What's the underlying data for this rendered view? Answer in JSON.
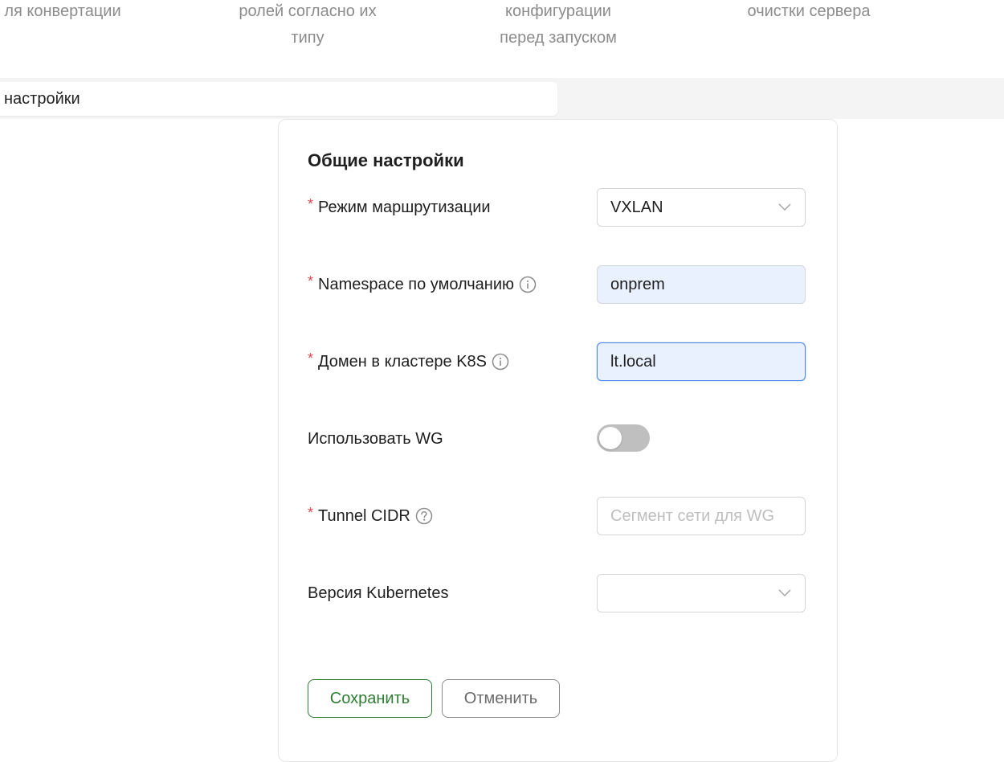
{
  "steps": [
    {
      "label": "ля конвертации"
    },
    {
      "label": "ролей согласно их\nтипу"
    },
    {
      "label": "конфигурации\nперед запуском"
    },
    {
      "label": "очистки сервера"
    }
  ],
  "tab": {
    "label": "настройки"
  },
  "form": {
    "title": "Общие настройки",
    "required_mark": "*",
    "routing_mode": {
      "label": "Режим маршрутизации",
      "value": "VXLAN"
    },
    "namespace": {
      "label": "Namespace по умолчанию",
      "value": "onprem"
    },
    "cluster_domain": {
      "label": "Домен в кластере K8S",
      "value": "lt.local"
    },
    "use_wg": {
      "label": "Использовать WG",
      "enabled": false
    },
    "tunnel_cidr": {
      "label": "Tunnel CIDR",
      "value": "",
      "placeholder": "Сегмент сети для WG"
    },
    "k8s_version": {
      "label": "Версия Kubernetes",
      "value": ""
    }
  },
  "buttons": {
    "save": "Сохранить",
    "cancel": "Отменить"
  },
  "colors": {
    "required": "#e5484d",
    "save_border": "#2e7d32",
    "focus_border": "#4a86e8",
    "filled_bg": "#e9f0fe",
    "toggle_off": "#bfbfbf"
  },
  "icons": {
    "info": "info-circle-icon",
    "help": "question-circle-icon",
    "chevron": "chevron-down-icon"
  }
}
